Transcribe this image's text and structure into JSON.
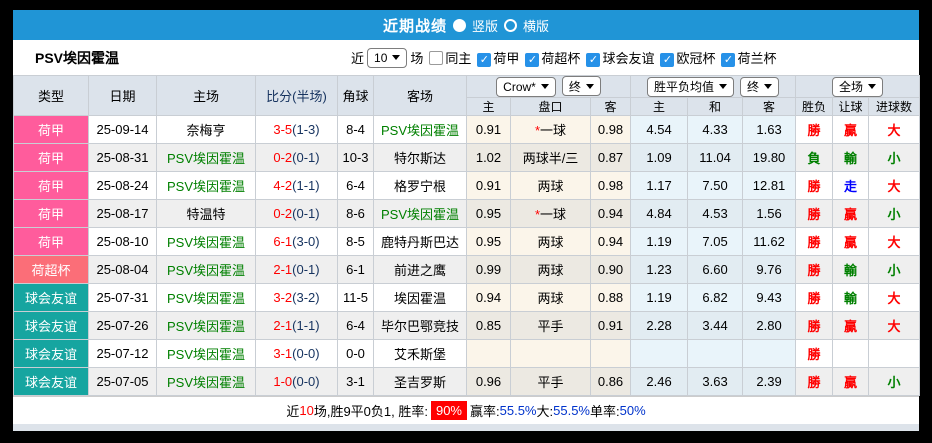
{
  "colors": {
    "accent_blue": "#2095d6",
    "win_red": "#ff0000",
    "lose_green": "#008000",
    "push_blue": "#0000ff",
    "half_navy": "#16335f",
    "badge_bg": "#ff0000",
    "stat_blue": "#0033cc",
    "league": {
      "荷甲": "#ff5c9c",
      "荷超杯": "#fb6e78",
      "球会友谊": "#16a5a0"
    }
  },
  "title_bar": {
    "title": "近期战绩",
    "radio_vertical": "竖版",
    "radio_horizontal": "横版",
    "selected": "竖版"
  },
  "filter": {
    "team": "PSV埃因霍温",
    "near_label": "近",
    "matches_value": "10",
    "matches_suffix": "场",
    "same_home_label": "同主",
    "same_home_checked": false,
    "leagues": [
      {
        "label": "荷甲",
        "checked": true
      },
      {
        "label": "荷超杯",
        "checked": true
      },
      {
        "label": "球会友谊",
        "checked": true
      },
      {
        "label": "欧冠杯",
        "checked": true
      },
      {
        "label": "荷兰杯",
        "checked": true
      }
    ]
  },
  "table": {
    "selects": {
      "company": "Crow*",
      "final_1": "终",
      "avg": "胜平负均值",
      "final_2": "终",
      "scope": "全场"
    },
    "headers": {
      "type": "类型",
      "date": "日期",
      "home": "主场",
      "score": "比分(半场)",
      "corner": "角球",
      "away": "客场",
      "sub": [
        "主",
        "盘口",
        "客",
        "主",
        "和",
        "客",
        "胜负",
        "让球",
        "进球数"
      ]
    },
    "rows": [
      {
        "type": "荷甲",
        "date": "25-09-14",
        "home": "奈梅亨",
        "home_green": false,
        "score": "3-5",
        "half": "(1-3)",
        "corner": "8-4",
        "away": "PSV埃因霍温",
        "away_green": true,
        "let_home": "0.91",
        "hdp_star": "*",
        "handicap": "一球",
        "let_away": "0.98",
        "avg_home": "4.54",
        "avg_draw": "4.33",
        "avg_away": "1.63",
        "result": "勝",
        "result_color": "red",
        "let_result": "贏",
        "let_color": "red",
        "goals": "大",
        "goals_color": "red"
      },
      {
        "type": "荷甲",
        "date": "25-08-31",
        "home": "PSV埃因霍温",
        "home_green": true,
        "score": "0-2",
        "half": "(0-1)",
        "corner": "10-3",
        "away": "特尔斯达",
        "away_green": false,
        "let_home": "1.02",
        "hdp_star": "",
        "handicap": "两球半/三",
        "let_away": "0.87",
        "avg_home": "1.09",
        "avg_draw": "11.04",
        "avg_away": "19.80",
        "result": "負",
        "result_color": "green",
        "let_result": "輸",
        "let_color": "green",
        "goals": "小",
        "goals_color": "green"
      },
      {
        "type": "荷甲",
        "date": "25-08-24",
        "home": "PSV埃因霍温",
        "home_green": true,
        "score": "4-2",
        "half": "(1-1)",
        "corner": "6-4",
        "away": "格罗宁根",
        "away_green": false,
        "let_home": "0.91",
        "hdp_star": "",
        "handicap": "两球",
        "let_away": "0.98",
        "avg_home": "1.17",
        "avg_draw": "7.50",
        "avg_away": "12.81",
        "result": "勝",
        "result_color": "red",
        "let_result": "走",
        "let_color": "blue",
        "goals": "大",
        "goals_color": "red"
      },
      {
        "type": "荷甲",
        "date": "25-08-17",
        "home": "特温特",
        "home_green": false,
        "score": "0-2",
        "half": "(0-1)",
        "corner": "8-6",
        "away": "PSV埃因霍温",
        "away_green": true,
        "let_home": "0.95",
        "hdp_star": "*",
        "handicap": "一球",
        "let_away": "0.94",
        "avg_home": "4.84",
        "avg_draw": "4.53",
        "avg_away": "1.56",
        "result": "勝",
        "result_color": "red",
        "let_result": "贏",
        "let_color": "red",
        "goals": "小",
        "goals_color": "green"
      },
      {
        "type": "荷甲",
        "date": "25-08-10",
        "home": "PSV埃因霍温",
        "home_green": true,
        "score": "6-1",
        "half": "(3-0)",
        "corner": "8-5",
        "away": "鹿特丹斯巴达",
        "away_green": false,
        "let_home": "0.95",
        "hdp_star": "",
        "handicap": "两球",
        "let_away": "0.94",
        "avg_home": "1.19",
        "avg_draw": "7.05",
        "avg_away": "11.62",
        "result": "勝",
        "result_color": "red",
        "let_result": "贏",
        "let_color": "red",
        "goals": "大",
        "goals_color": "red"
      },
      {
        "type": "荷超杯",
        "date": "25-08-04",
        "home": "PSV埃因霍温",
        "home_green": true,
        "score": "2-1",
        "half": "(0-1)",
        "corner": "6-1",
        "away": "前进之鹰",
        "away_green": false,
        "let_home": "0.99",
        "hdp_star": "",
        "handicap": "两球",
        "let_away": "0.90",
        "avg_home": "1.23",
        "avg_draw": "6.60",
        "avg_away": "9.76",
        "result": "勝",
        "result_color": "red",
        "let_result": "輸",
        "let_color": "green",
        "goals": "小",
        "goals_color": "green"
      },
      {
        "type": "球会友谊",
        "date": "25-07-31",
        "home": "PSV埃因霍温",
        "home_green": true,
        "score": "3-2",
        "half": "(3-2)",
        "corner": "11-5",
        "away": "埃因霍温",
        "away_green": false,
        "let_home": "0.94",
        "hdp_star": "",
        "handicap": "两球",
        "let_away": "0.88",
        "avg_home": "1.19",
        "avg_draw": "6.82",
        "avg_away": "9.43",
        "result": "勝",
        "result_color": "red",
        "let_result": "輸",
        "let_color": "green",
        "goals": "大",
        "goals_color": "red"
      },
      {
        "type": "球会友谊",
        "date": "25-07-26",
        "home": "PSV埃因霍温",
        "home_green": true,
        "score": "2-1",
        "half": "(1-1)",
        "corner": "6-4",
        "away": "毕尔巴鄂竞技",
        "away_green": false,
        "let_home": "0.85",
        "hdp_star": "",
        "handicap": "平手",
        "let_away": "0.91",
        "avg_home": "2.28",
        "avg_draw": "3.44",
        "avg_away": "2.80",
        "result": "勝",
        "result_color": "red",
        "let_result": "贏",
        "let_color": "red",
        "goals": "大",
        "goals_color": "red"
      },
      {
        "type": "球会友谊",
        "date": "25-07-12",
        "home": "PSV埃因霍温",
        "home_green": true,
        "score": "3-1",
        "half": "(0-0)",
        "corner": "0-0",
        "away": "艾禾斯堡",
        "away_green": false,
        "let_home": "",
        "hdp_star": "",
        "handicap": "",
        "let_away": "",
        "avg_home": "",
        "avg_draw": "",
        "avg_away": "",
        "result": "勝",
        "result_color": "red",
        "let_result": "",
        "let_color": "",
        "goals": "",
        "goals_color": ""
      },
      {
        "type": "球会友谊",
        "date": "25-07-05",
        "home": "PSV埃因霍温",
        "home_green": true,
        "score": "1-0",
        "half": "(0-0)",
        "corner": "3-1",
        "away": "圣吉罗斯",
        "away_green": false,
        "let_home": "0.96",
        "hdp_star": "",
        "handicap": "平手",
        "let_away": "0.86",
        "avg_home": "2.46",
        "avg_draw": "3.63",
        "avg_away": "2.39",
        "result": "勝",
        "result_color": "red",
        "let_result": "贏",
        "let_color": "red",
        "goals": "小",
        "goals_color": "green"
      }
    ]
  },
  "footer": {
    "segments": [
      {
        "text": "近"
      },
      {
        "text": "10",
        "color": "red"
      },
      {
        "text": "场,胜9平0负1, 胜率:"
      },
      {
        "text": "90%",
        "badge": true
      },
      {
        "text": "赢率:"
      },
      {
        "text": "55.5%",
        "color": "blue"
      },
      {
        "text": " 大:"
      },
      {
        "text": "55.5%",
        "color": "blue"
      },
      {
        "text": " 单率:"
      },
      {
        "text": "50%",
        "color": "blue"
      }
    ]
  }
}
